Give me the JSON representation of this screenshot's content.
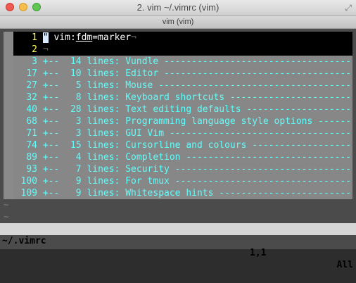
{
  "window": {
    "title": "2. vim ~/.vimrc (vim)",
    "tab_label": "vim (vim)",
    "fullscreen_icon": "fullscreen-arrows-icon"
  },
  "editor": {
    "line1": {
      "number": "1",
      "cursor_char": "\"",
      "pre": " vim:",
      "underlined": "fdm",
      "post": "=marker",
      "eol": "¬"
    },
    "line2": {
      "number": "2",
      "eol": "¬"
    },
    "folds": [
      {
        "number": "3",
        "text": "+--  14 lines: Vundle ------------------------------------------------------------"
      },
      {
        "number": "17",
        "text": "+--  10 lines: Editor ------------------------------------------------------------"
      },
      {
        "number": "27",
        "text": "+--   5 lines: Mouse -------------------------------------------------------------"
      },
      {
        "number": "32",
        "text": "+--   8 lines: Keyboard shortcuts ------------------------------------------------"
      },
      {
        "number": "40",
        "text": "+--  28 lines: Text editing defaults ---------------------------------------------"
      },
      {
        "number": "68",
        "text": "+--   3 lines: Programming language style options --------------------------------"
      },
      {
        "number": "71",
        "text": "+--   3 lines: GUI Vim -----------------------------------------------------------"
      },
      {
        "number": "74",
        "text": "+--  15 lines: Cursorline and colours --------------------------------------------"
      },
      {
        "number": "89",
        "text": "+--   4 lines: Completion --------------------------------------------------------"
      },
      {
        "number": "93",
        "text": "+--   7 lines: Security ----------------------------------------------------------"
      },
      {
        "number": "100",
        "text": "+--   9 lines: For tmux ----------------------------------------------------------"
      },
      {
        "number": "109",
        "text": "+--   9 lines: Whitespace hints --------------------------------------------------"
      }
    ],
    "tilde": "~"
  },
  "statusline": {
    "filename": "~/.vimrc",
    "position": "1,1",
    "percent": "All"
  }
}
